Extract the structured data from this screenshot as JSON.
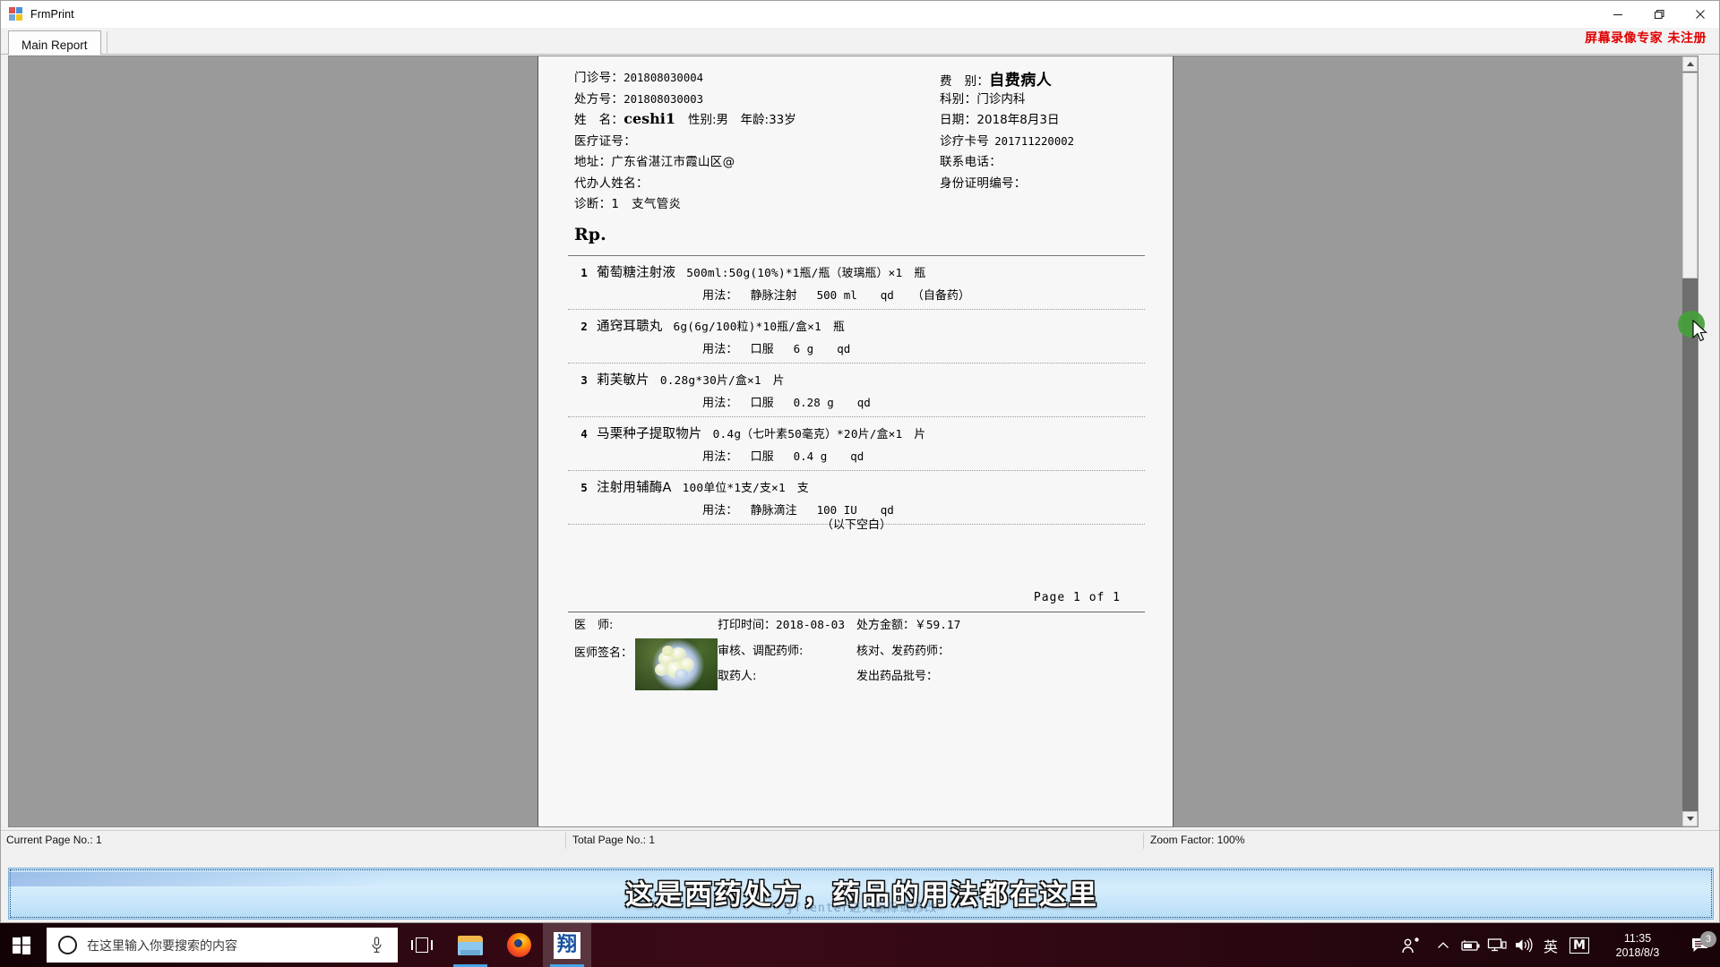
{
  "window": {
    "title": "FrmPrint",
    "icon": "application-icon",
    "minimize_label": "—",
    "restore_label": "❐",
    "close_label": "✕"
  },
  "watermark": {
    "text": "屏幕录像专家 未注册"
  },
  "tabs": [
    {
      "label": "Main Report",
      "selected": true
    }
  ],
  "report": {
    "header": {
      "rows": [
        {
          "label": "门诊号：",
          "value": "201808030004",
          "value_style": "mono",
          "right_label": "费　别：",
          "right_value": "自费病人",
          "right_style": "big-bold"
        },
        {
          "label": "处方号：",
          "value": "201808030003",
          "value_style": "mono",
          "right_label": "科别：",
          "right_value": "门诊内科",
          "right_style": "cjk"
        },
        {
          "label": "姓　名：",
          "value": "ceshi1",
          "value_style": "name-bold",
          "extra": "性别:男　年龄:33岁",
          "right_label": "日期：",
          "right_value": "2018年8月3日",
          "right_style": "cjk"
        },
        {
          "label": "医疗证号：",
          "value": "",
          "value_style": "mono",
          "right_label": "诊疗卡号",
          "right_value": "201711220002",
          "right_style": "mono"
        },
        {
          "label": "地址：广东省湛江市霞山区@",
          "value": "",
          "value_style": "cjk",
          "right_label": "联系电话：",
          "right_value": "",
          "right_style": "cjk"
        },
        {
          "label": "代办人姓名：",
          "value": "",
          "value_style": "cjk",
          "right_label": "身份证明编号：",
          "right_value": "",
          "right_style": "cjk"
        },
        {
          "label": "诊断：1　支气管炎",
          "value": "",
          "value_style": "cjk",
          "right_label": "",
          "right_value": "",
          "right_style": "cjk"
        }
      ]
    },
    "rp_title": "Rp.",
    "items": [
      {
        "no": "1",
        "name": "葡萄糖注射液",
        "spec": "500ml:50g(10%)*1瓶/瓶（玻璃瓶）×1　瓶",
        "usage_label": "用法：",
        "route": "静脉注射",
        "dose": "500 ml",
        "freq": "qd",
        "note": "（自备药）"
      },
      {
        "no": "2",
        "name": "通窍耳聩丸",
        "spec": "6g(6g/100粒)*10瓶/盒×1　瓶",
        "usage_label": "用法：",
        "route": "口服",
        "dose": "6 g",
        "freq": "qd",
        "note": ""
      },
      {
        "no": "3",
        "name": "莉芙敏片",
        "spec": "0.28g*30片/盒×1　片",
        "usage_label": "用法：",
        "route": "口服",
        "dose": "0.28 g",
        "freq": "qd",
        "note": ""
      },
      {
        "no": "4",
        "name": "马栗种子提取物片",
        "spec": "0.4g（七叶素50毫克）*20片/盒×1　片",
        "usage_label": "用法：",
        "route": "口服",
        "dose": "0.4 g",
        "freq": "qd",
        "note": ""
      },
      {
        "no": "5",
        "name": "注射用辅酶A",
        "spec": "100单位*1支/支×1　支",
        "usage_label": "用法：",
        "route": "静脉滴注",
        "dose": "100 IU",
        "freq": "qd",
        "note": ""
      }
    ],
    "blank_notice": "（以下空白）",
    "page_indicator": "Page 1 of 1",
    "footer": {
      "doctor_label": "医　师:",
      "print_time_label": "打印时间：",
      "print_time_value": "2018-08-03",
      "amount_label": "处方金额：",
      "amount_value": "￥59.17",
      "signature_label": "医师签名：",
      "signature_image": "hydrangea-photo",
      "review_label": "审核、调配药师:",
      "check_label": "核对、发药药师：",
      "receiver_label": "取药人:",
      "batch_label": "发出药品批号："
    }
  },
  "statusbar": {
    "current_page": "Current Page No.: 1",
    "total_page": "Total Page No.: 1",
    "zoom_factor": "Zoom Factor: 100%"
  },
  "caption": {
    "text": "这是西药处方，药品的用法都在这里",
    "ghost_text": "jf enter进入删除或修改"
  },
  "taskbar": {
    "start_label": "windows-start",
    "search_placeholder": "在这里输入你要搜索的内容",
    "apps": [
      {
        "name": "task-view",
        "label": ""
      },
      {
        "name": "file-explorer",
        "label": ""
      },
      {
        "name": "firefox",
        "label": ""
      },
      {
        "name": "xdb-app",
        "label": "翔"
      }
    ],
    "tray": {
      "people": "people-icon",
      "chevron": "⌃",
      "battery": "battery-icon",
      "network": "network-icon",
      "volume": "volume-icon",
      "ime": "英",
      "m_badge": "M",
      "time": "11:35",
      "date": "2018/8/3",
      "notification_count": "3"
    }
  },
  "colors": {
    "accent": "#4aa3e8",
    "watermark_red": "#e00000",
    "taskbar": "#3b0a16",
    "caption_blue": "#c4e4fa",
    "click_green": "#45a03a"
  }
}
